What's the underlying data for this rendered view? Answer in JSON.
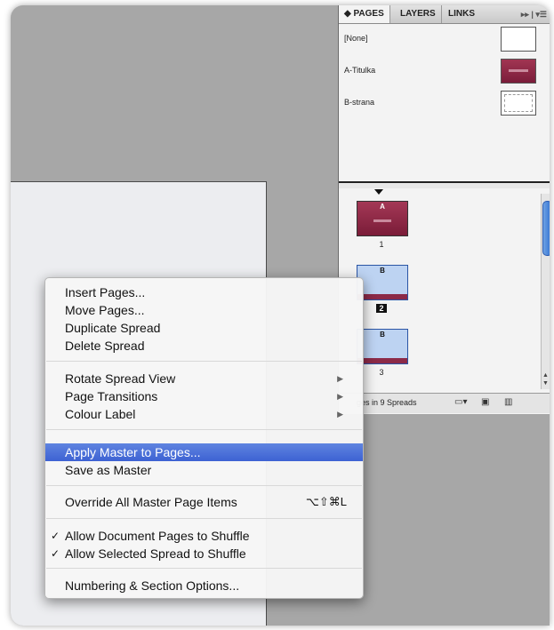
{
  "pages_panel": {
    "tabs": [
      "PAGES",
      "LAYERS",
      "LINKS"
    ],
    "masters": [
      {
        "label": "[None]"
      },
      {
        "label": "A-Titulka"
      },
      {
        "label": "B-strana"
      }
    ],
    "pages": [
      {
        "number": "1",
        "master": "A"
      },
      {
        "number": "2",
        "master": "B"
      },
      {
        "number": "3",
        "master": "B"
      }
    ],
    "status": "ges in 9 Spreads",
    "colors": {
      "master_red": "#8c2a48",
      "page_blue": "#bdd3f2",
      "scroll_blue": "#3d74d3"
    }
  },
  "context_menu": {
    "items": [
      {
        "label": "Insert Pages..."
      },
      {
        "label": "Move Pages..."
      },
      {
        "label": "Duplicate Spread"
      },
      {
        "label": "Delete Spread"
      },
      {
        "label": "Rotate Spread View"
      },
      {
        "label": "Page Transitions"
      },
      {
        "label": "Colour Label"
      },
      {
        "label": "Apply Master to Pages..."
      },
      {
        "label": "Save as Master"
      },
      {
        "label": "Override All Master Page Items",
        "shortcut": "⌥⇧⌘L"
      },
      {
        "label": "Allow Document Pages to Shuffle",
        "checked": true
      },
      {
        "label": "Allow Selected Spread to Shuffle",
        "checked": true
      },
      {
        "label": "Numbering & Section Options..."
      }
    ],
    "highlight_color": "#3d62d3"
  }
}
